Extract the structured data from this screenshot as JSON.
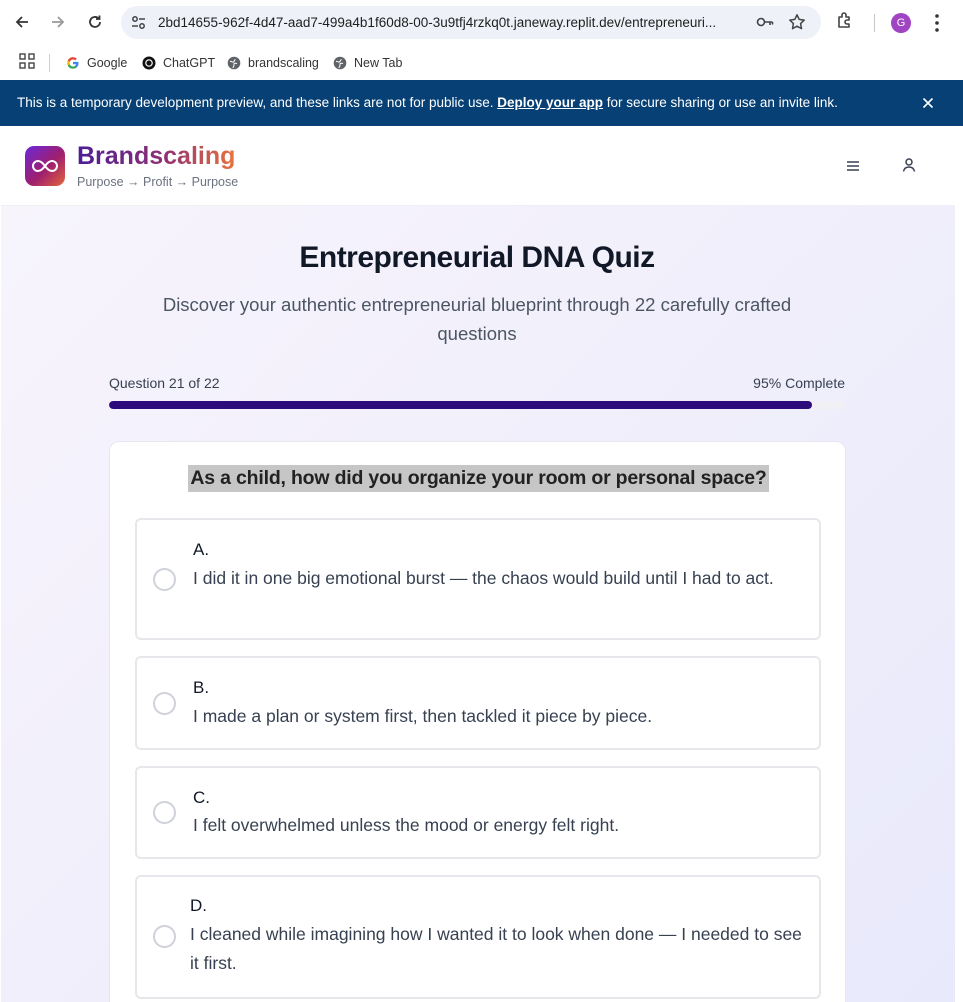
{
  "browser": {
    "url": "2bd14655-962f-4d47-aad7-499a4b1f60d8-00-3u9tfj4rzkq0t.janeway.replit.dev/entrepreneuri...",
    "profile_initial": "G",
    "profile_color": "#a144c4",
    "bookmarks": [
      {
        "label": "Google",
        "icon": "google-icon"
      },
      {
        "label": "ChatGPT",
        "icon": "chatgpt-icon"
      },
      {
        "label": "brandscaling",
        "icon": "globe-icon"
      },
      {
        "label": "New Tab",
        "icon": "globe-icon"
      }
    ]
  },
  "banner": {
    "text_before": "This is a temporary development preview, and these links are not for public use. ",
    "link": "Deploy your app",
    "text_after": " for secure sharing or use an invite link.",
    "color": "#074074"
  },
  "header": {
    "brand": "Brandscaling",
    "tagline": "Purpose → Profit → Purpose",
    "logo_glyph": "∞"
  },
  "quiz": {
    "title": "Entrepreneurial DNA Quiz",
    "subtitle": "Discover your authentic entrepreneurial blueprint through 22 carefully crafted questions",
    "progress_label": "Question 21 of 22",
    "complete_label": "95% Complete",
    "progress_fraction": 0.955,
    "progress_color": "#2e0b7a",
    "question": "As a child, how did you organize your room or personal space?",
    "options": [
      {
        "letter": "A.",
        "text": "I did it in one big emotional burst — the chaos would build until I had to act."
      },
      {
        "letter": "B.",
        "text": "I made a plan or system first, then tackled it piece by piece."
      },
      {
        "letter": "C.",
        "text": "I felt overwhelmed unless the mood or energy felt right."
      },
      {
        "letter": "D.",
        "text": "I cleaned while imagining how I wanted it to look when done — I needed to see it first."
      }
    ]
  }
}
